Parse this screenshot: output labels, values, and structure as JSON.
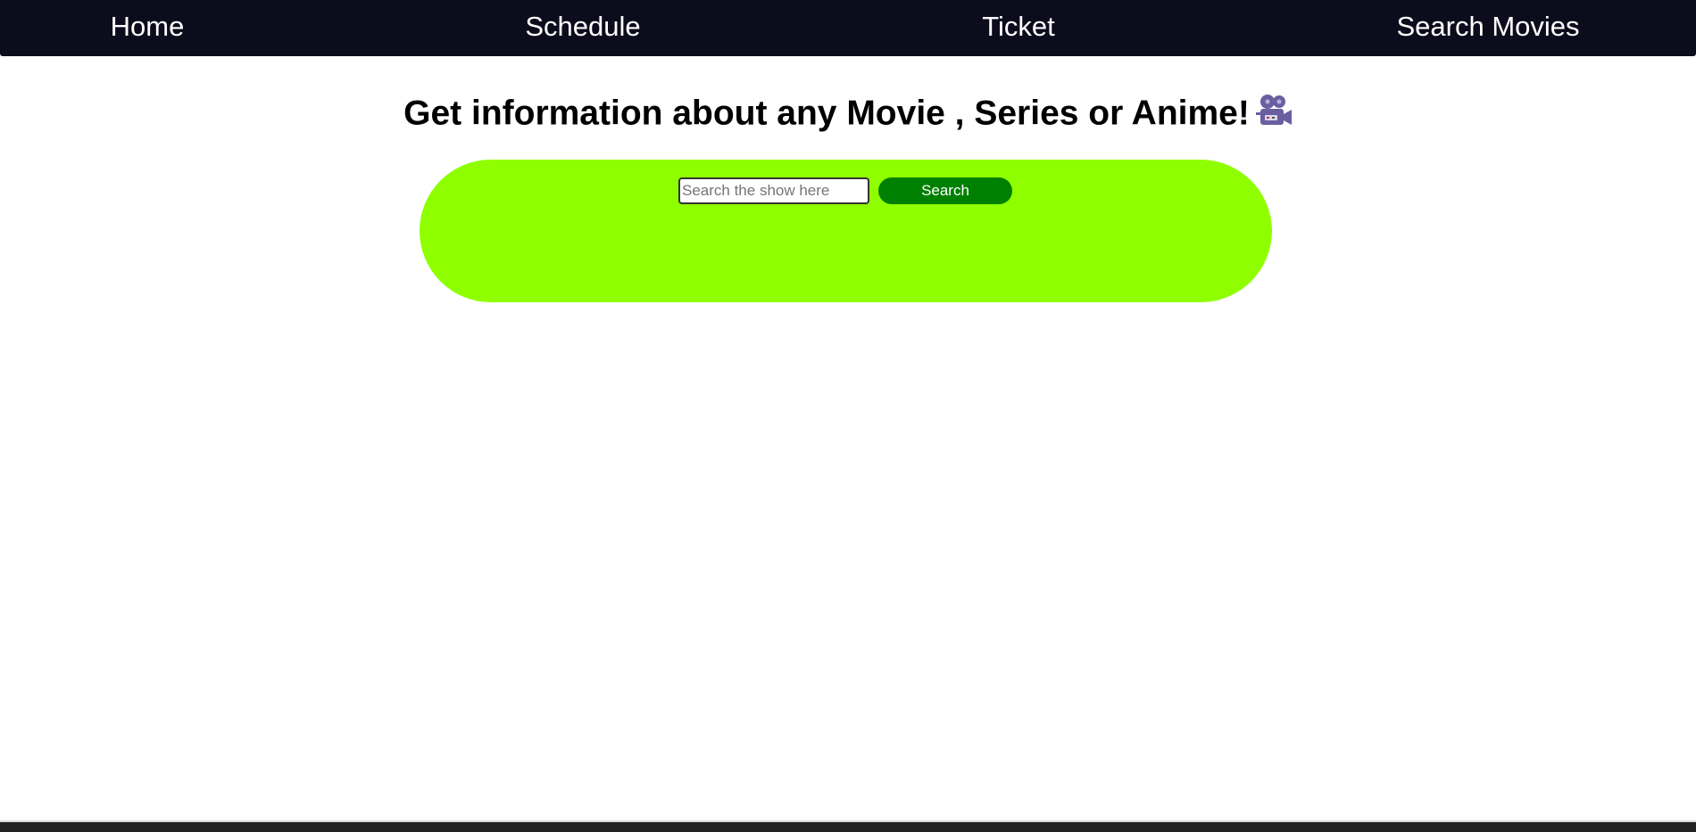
{
  "nav": {
    "items": [
      {
        "label": "Home"
      },
      {
        "label": "Schedule"
      },
      {
        "label": "Ticket"
      },
      {
        "label": "Search Movies"
      }
    ]
  },
  "header": {
    "title": "Get information about any Movie , Series or Anime!",
    "icon": "movie-camera-icon"
  },
  "search": {
    "placeholder": "Search the show here",
    "value": "",
    "button_label": "Search"
  },
  "colors": {
    "nav_bg": "#0c0c1d",
    "panel_bg": "#8fff00",
    "button_bg": "#008000",
    "icon": "#6a5fa0"
  }
}
